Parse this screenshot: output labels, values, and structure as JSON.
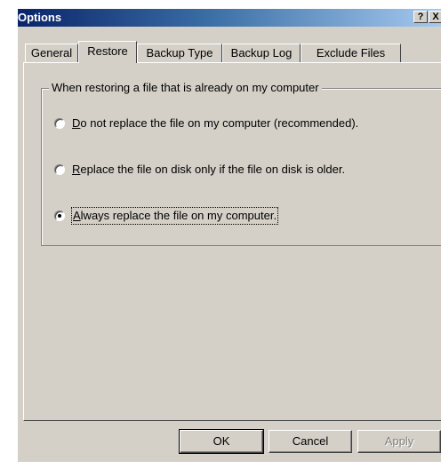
{
  "window": {
    "title": "Options",
    "help_glyph": "?",
    "close_glyph": "X"
  },
  "tabs": [
    {
      "label": "General",
      "active": false
    },
    {
      "label": "Restore",
      "active": true
    },
    {
      "label": "Backup Type",
      "active": false
    },
    {
      "label": "Backup Log",
      "active": false
    },
    {
      "label": "Exclude Files",
      "active": false
    }
  ],
  "group": {
    "title": "When restoring a file that is already on my computer",
    "options": [
      {
        "mnemonic": "D",
        "rest": "o not replace the file on my computer (recommended).",
        "checked": false
      },
      {
        "mnemonic": "R",
        "rest": "eplace the file on disk only if the file on disk is older.",
        "checked": false
      },
      {
        "mnemonic": "A",
        "rest": "lways replace the file on my computer.",
        "checked": true
      }
    ]
  },
  "buttons": {
    "ok": "OK",
    "cancel": "Cancel",
    "apply": "Apply"
  },
  "colors": {
    "title_gradient_start": "#0a246a",
    "title_gradient_end": "#a6caf0",
    "face": "#d4d0c8"
  }
}
